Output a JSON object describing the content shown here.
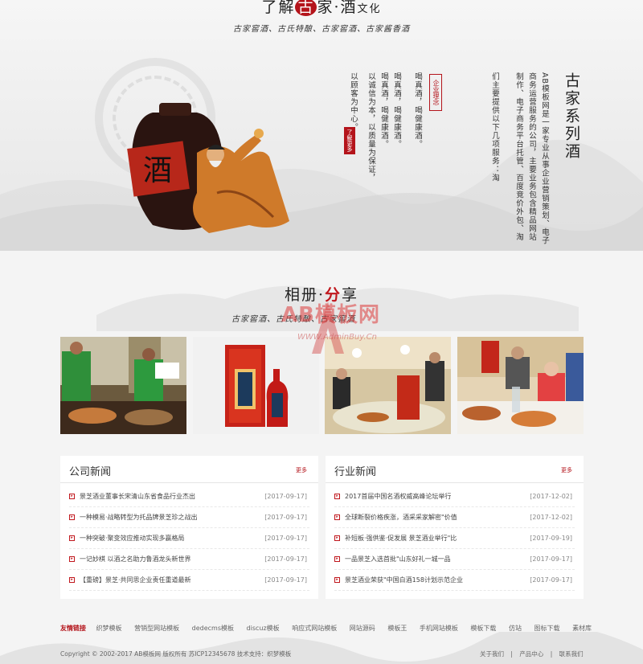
{
  "about": {
    "title_pre": "了解",
    "title_hl": "古",
    "title_post": "家·酒",
    "title_small": "文化",
    "subtitle": "古家窖酒、古氏特酿、古家窖酒、古家酱香酒",
    "series_title": "古家系列酒",
    "intro_cols": [
      "AB模板网是一家专业从事企业营销策划、电子",
      "商务运营服务的公司，主要业务包含精品网站",
      "制作、电子商务平台托管、百度竞价外包、淘",
      "们主要提供以下几项服务：淘"
    ],
    "concept_label": "企业理念",
    "concept_cols": [
      "喝真酒，喝健康酒。",
      "喝真酒，喝健康酒。",
      "以诚信为本，以质量为保证，",
      "以顾客为中心。"
    ],
    "seal_text": "了解更多",
    "jar_char": "酒"
  },
  "gallery": {
    "title_pre": "相册·",
    "title_hl": "分",
    "title_post": "享",
    "subtitle": "古家窖酒、古氏特酿、古家窖酒",
    "watermark": "AB模板网",
    "watermark_url": "WWW.AdminBuy.Cn"
  },
  "news": {
    "company": {
      "title": "公司新闻",
      "more": "更多",
      "items": [
        {
          "title": "景芝酒业董事长宋清山东省食品行业杰出",
          "date": "[2017-09-17]"
        },
        {
          "title": "一种模易·战略转型为托品牌景芝珍之战出",
          "date": "[2017-09-17]"
        },
        {
          "title": "一种突破·聚变效应推动实现多赢格局",
          "date": "[2017-09-17]"
        },
        {
          "title": "一记妙棋 以酒之名助力鲁酒龙头新世界",
          "date": "[2017-09-17]"
        },
        {
          "title": "【重磅】景芝·共同思企业责任重道最新",
          "date": "[2017-09-17]"
        }
      ]
    },
    "industry": {
      "title": "行业新闻",
      "more": "更多",
      "items": [
        {
          "title": "2017首届中国名酒权威高峰论坛举行",
          "date": "[2017-12-02]"
        },
        {
          "title": "全球断裂价格疾涨，酒采采家解密\"价值",
          "date": "[2017-12-02]"
        },
        {
          "title": "补短板·强供鉴·促发展 景芝酒业举行\"比",
          "date": "[2017-09-19]"
        },
        {
          "title": "一品景芝入选首批\"山东好礼一城一品",
          "date": "[2017-09-17]"
        },
        {
          "title": "景芝酒业荣获\"中国白酒158计划示范企业",
          "date": "[2017-09-17]"
        }
      ]
    }
  },
  "footer": {
    "links_label": "友情链接",
    "links": [
      "织梦模板",
      "营销型网站模板",
      "dedecms模板",
      "discuz模板",
      "响应式网站模板",
      "网站源码",
      "模板王",
      "手机网站模板",
      "模板下载",
      "仿站",
      "图标下载",
      "素材库"
    ],
    "copyright": "Copyright © 2002-2017 AB模板网 版权所有 苏ICP12345678 技术支持：织梦模板",
    "nav": [
      "关于我们",
      "|",
      "产品中心",
      "|",
      "联系我们"
    ]
  },
  "colors": {
    "accent": "#b4141b",
    "panel_bg": "#ffffff",
    "page_bg": "#f4f4f4"
  }
}
